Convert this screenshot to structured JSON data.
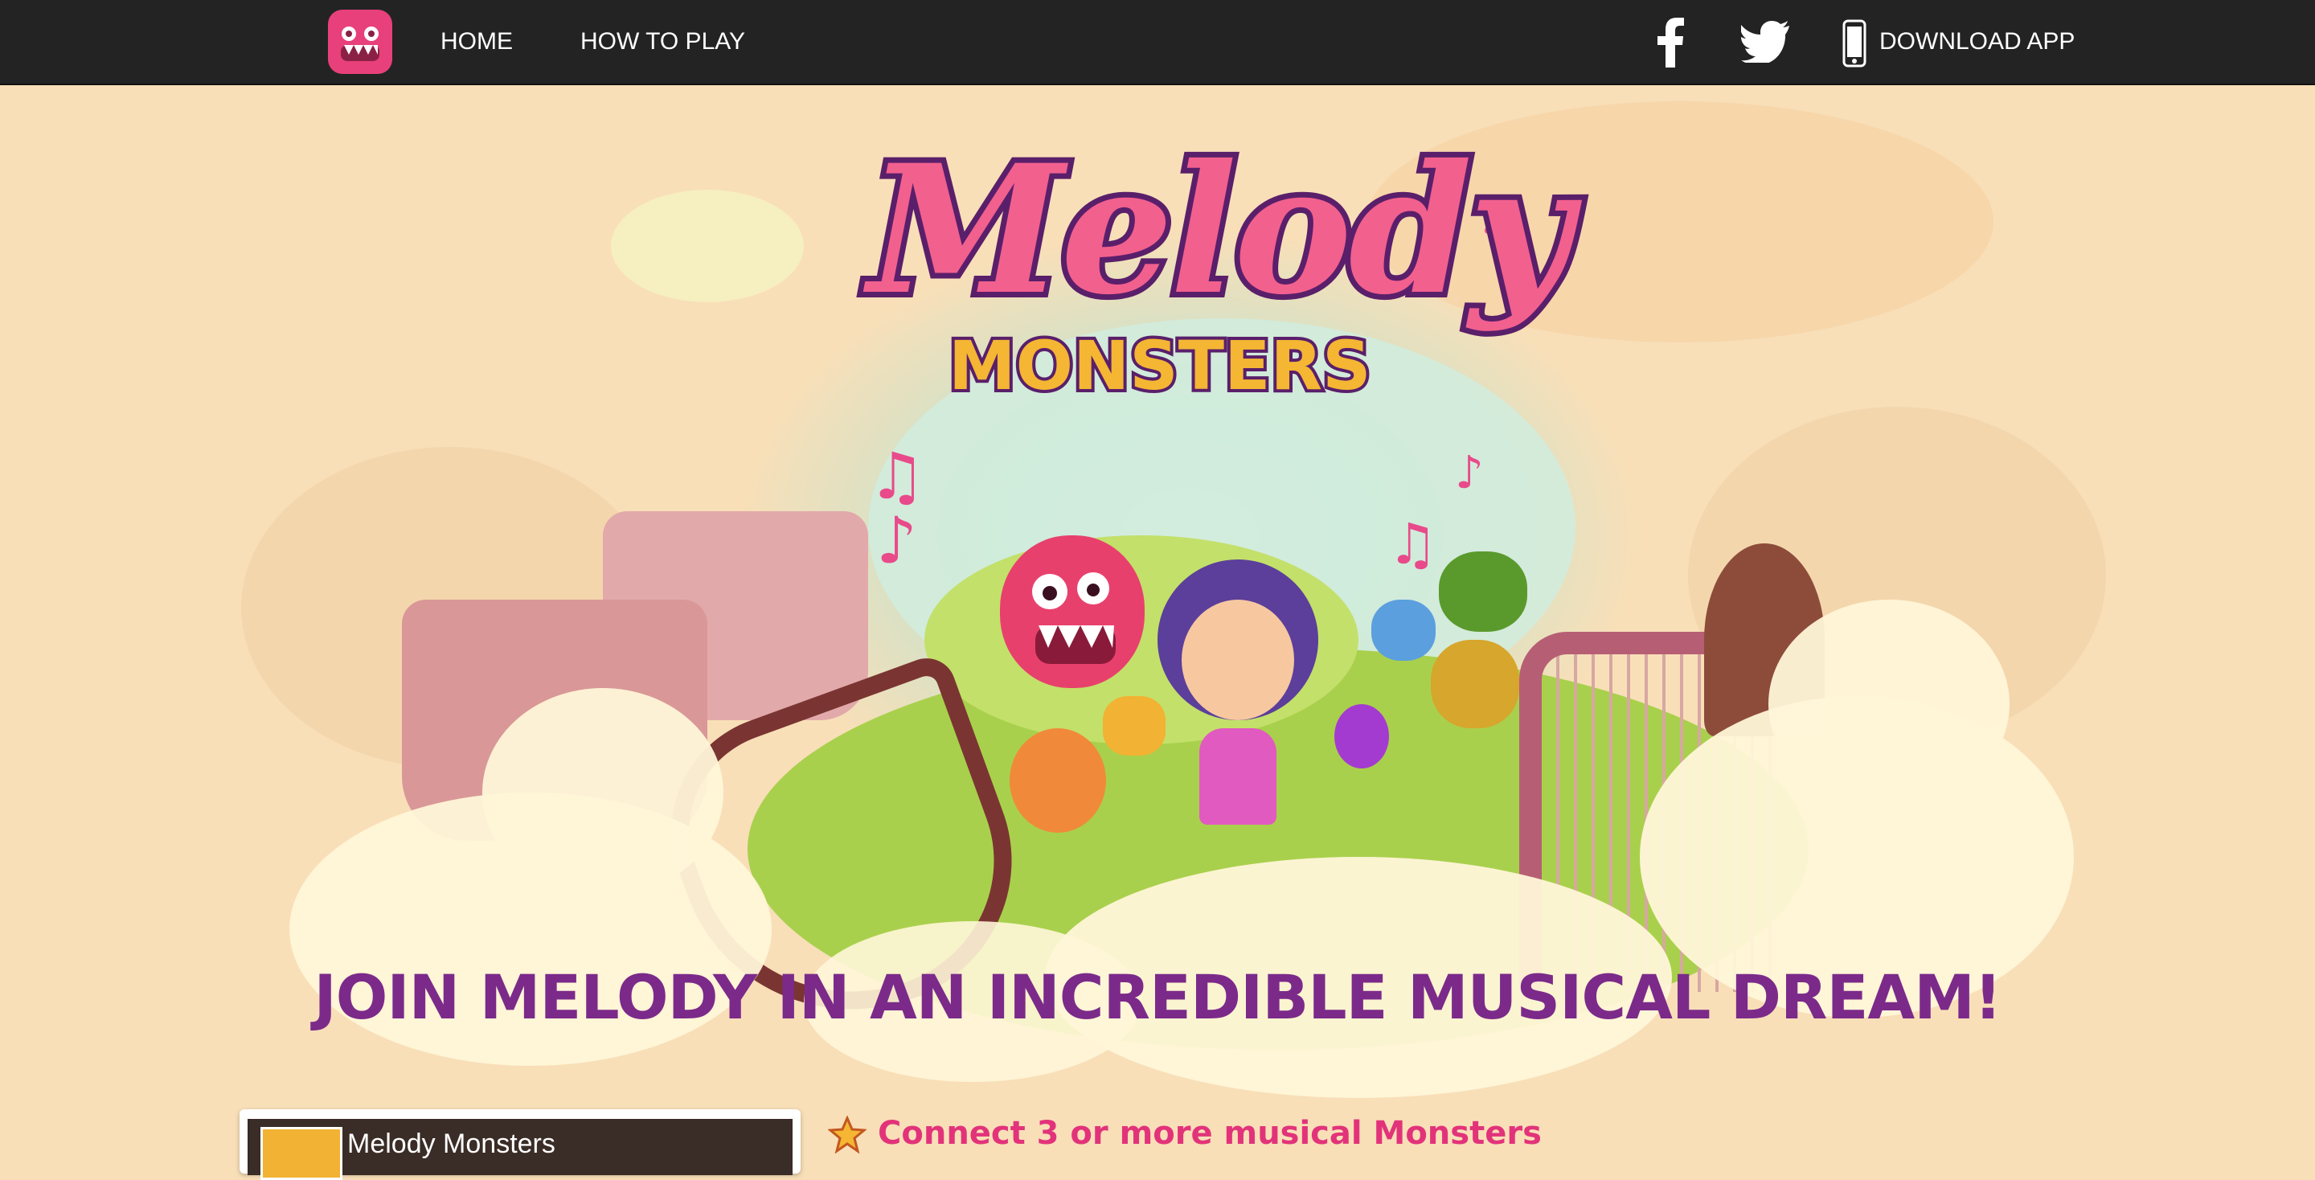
{
  "nav": {
    "home": "HOME",
    "how_to_play": "HOW TO PLAY",
    "download": "DOWNLOAD APP",
    "icons": [
      "app-logo-icon",
      "facebook-icon",
      "twitter-icon",
      "phone-icon"
    ]
  },
  "hero": {
    "logo_line1": "Melody",
    "logo_line2": "MONSTERS",
    "headline": "JOIN MELODY IN AN INCREDIBLE MUSICAL DREAM!"
  },
  "video": {
    "title": "Melody Monsters"
  },
  "features": [
    {
      "text": "Connect 3 or more musical Monsters",
      "icon": "star-icon"
    }
  ],
  "colors": {
    "nav_bg": "#232323",
    "brand_pink": "#e8407a",
    "headline_purple": "#7b2a8a",
    "feature_pink": "#e2337a",
    "hero_bg": "#f8dfb8"
  }
}
